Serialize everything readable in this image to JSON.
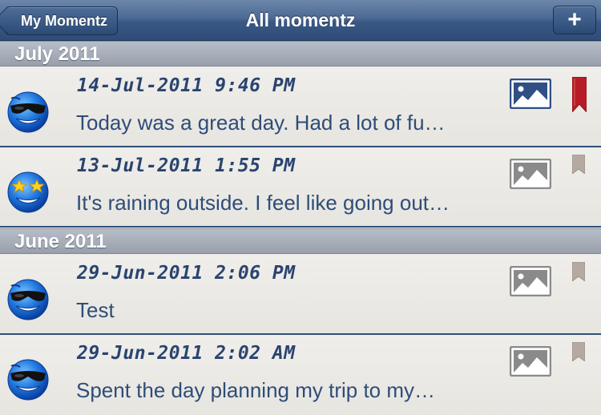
{
  "nav": {
    "back_label": "My Momentz",
    "title": "All momentz",
    "add_label": "+"
  },
  "sections": [
    {
      "title": "July 2011",
      "entries": [
        {
          "date": "14-Jul-2011 9:46 PM",
          "text": "Today was a great day. Had a lot of fu…",
          "avatar": "cool-sunglasses-smiley-icon",
          "photo": "photo-icon",
          "bookmark": "bookmark-icon",
          "bookmarked": true
        },
        {
          "date": "13-Jul-2011 1:55 PM",
          "text": "It's raining outside. I feel like going out…",
          "avatar": "star-eyes-smiley-icon",
          "photo": "photo-icon",
          "bookmark": "bookmark-icon",
          "bookmarked": false
        }
      ]
    },
    {
      "title": "June 2011",
      "entries": [
        {
          "date": "29-Jun-2011 2:06 PM",
          "text": "Test",
          "avatar": "cool-sunglasses-smiley-icon",
          "photo": "photo-icon",
          "bookmark": "bookmark-icon",
          "bookmarked": false
        },
        {
          "date": "29-Jun-2011 2:02 AM",
          "text": "Spent the day planning my trip to my…",
          "avatar": "cool-sunglasses-smiley-icon",
          "photo": "photo-icon",
          "bookmark": "bookmark-icon",
          "bookmarked": false
        }
      ]
    }
  ],
  "colors": {
    "nav_blue": "#3a5884",
    "section_gray": "#a7aeb9",
    "text_blue": "#2e4d78",
    "bookmark_active": "#b71c26",
    "bookmark_inactive": "#b5aaa2",
    "photo_active": "#2f4f85",
    "photo_inactive": "#8a8a8a"
  }
}
